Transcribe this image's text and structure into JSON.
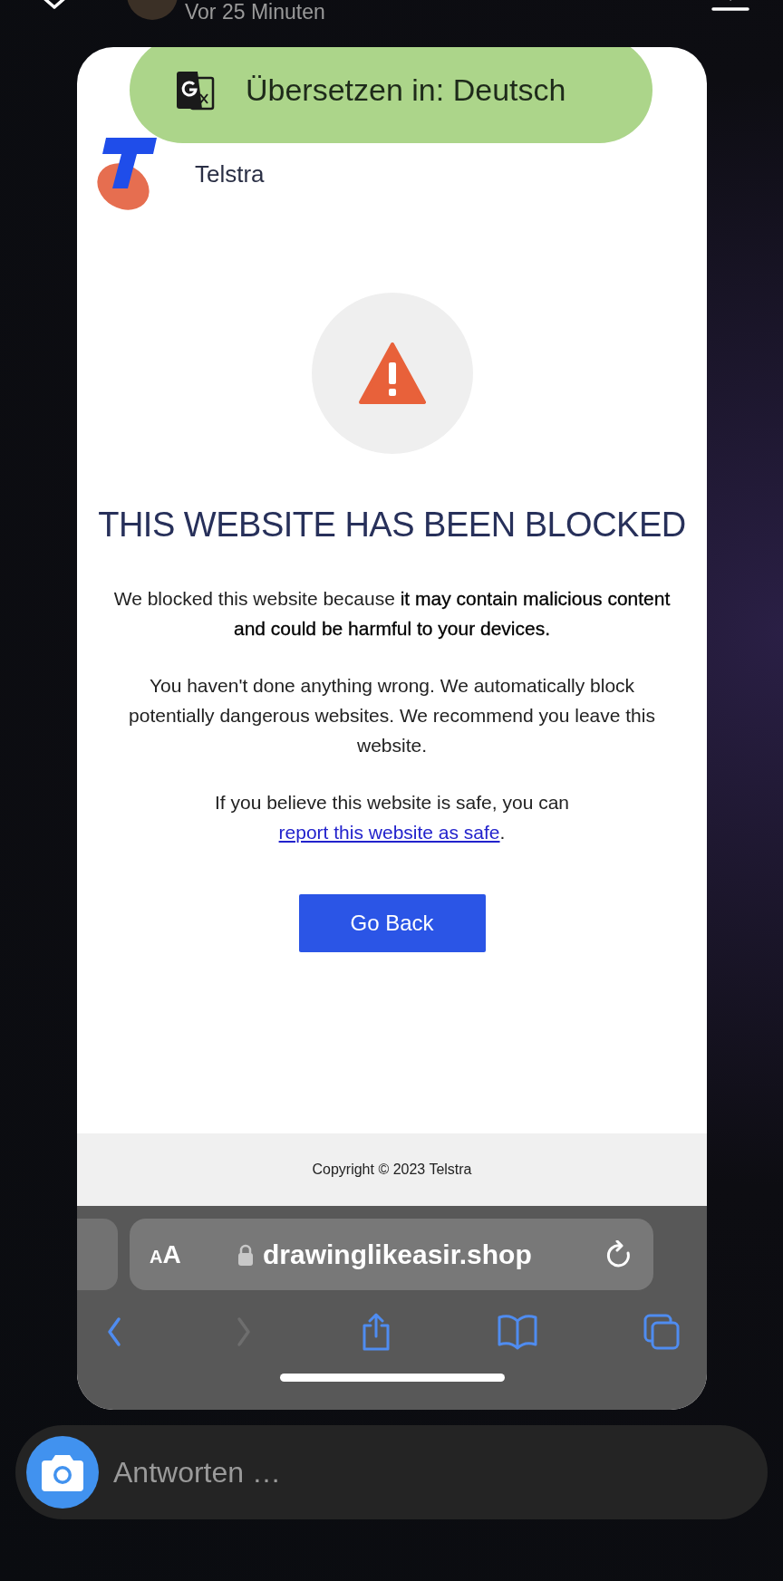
{
  "header": {
    "time": "Vor 25 Minuten"
  },
  "translate_banner": {
    "label": "Übersetzen in: Deutsch"
  },
  "page": {
    "brand": "Telstra",
    "heading": "THIS WEBSITE HAS BEEN BLOCKED",
    "paragraphs": [
      {
        "text": "We blocked this website because **it may contain malicious content and could be harmful to your devices.**"
      },
      {
        "text": "You haven't done anything wrong. We automatically block potentially dangerous websites. We recommend you leave this website."
      },
      {
        "text": "If you believe this website is safe, you can ",
        "link": "report this website as safe",
        "after": "."
      }
    ],
    "button": "Go Back",
    "footer": "Copyright © 2023 Telstra"
  },
  "browser": {
    "text_size": "AA",
    "url": "drawinglikeasir.shop",
    "toolbar": [
      {
        "kind": "back",
        "disabled": false
      },
      {
        "kind": "forward",
        "disabled": true
      },
      {
        "kind": "share",
        "disabled": false
      },
      {
        "kind": "bookmarks",
        "disabled": false
      },
      {
        "kind": "tabs",
        "disabled": false
      }
    ]
  },
  "reply": {
    "placeholder": "Antworten …"
  }
}
